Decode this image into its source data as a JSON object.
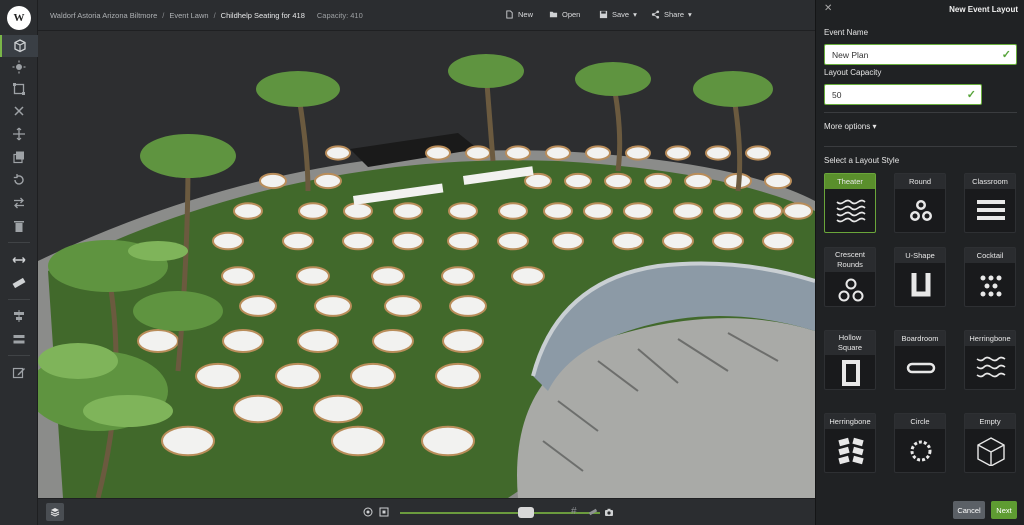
{
  "breadcrumb": {
    "venue": "Waldorf Astoria Arizona Biltmore",
    "space": "Event Lawn",
    "event": "Childhelp Seating for 418",
    "capacity": "Capacity: 410"
  },
  "toolbar": {
    "new_label": "New",
    "open_label": "Open",
    "save_label": "Save",
    "share_label": "Share"
  },
  "left_tools": [
    "cube-icon",
    "sun-icon",
    "frame-icon",
    "close-icon",
    "move-icon",
    "copy-icon",
    "rotate-icon",
    "swap-icon",
    "trash-icon",
    "measure-icon",
    "ruler-icon",
    "align-icon",
    "distribute-icon",
    "edit-icon"
  ],
  "zoom": {
    "level": 0.63
  },
  "panel": {
    "title": "New Event Layout",
    "event_name_label": "Event Name",
    "event_name_value": "New Plan",
    "capacity_label": "Layout Capacity",
    "capacity_value": "50",
    "more_options": "More options ▾",
    "style_label": "Select a Layout Style",
    "styles": [
      {
        "name": "Theater",
        "icon": "theater-icon",
        "selected": true
      },
      {
        "name": "Round",
        "icon": "round-icon"
      },
      {
        "name": "Classroom",
        "icon": "classroom-icon"
      },
      {
        "name": "Crescent\nRounds",
        "icon": "crescent-rounds-icon"
      },
      {
        "name": "U-Shape",
        "icon": "u-shape-icon"
      },
      {
        "name": "Cocktail",
        "icon": "cocktail-icon"
      },
      {
        "name": "Hollow\nSquare",
        "icon": "hollow-square-icon"
      },
      {
        "name": "Boardroom",
        "icon": "boardroom-icon"
      },
      {
        "name": "Herringbone",
        "icon": "herringbone-icon"
      },
      {
        "name": "Herringbone",
        "icon": "herringbone-alt-icon"
      },
      {
        "name": "Circle",
        "icon": "circle-icon"
      },
      {
        "name": "Empty",
        "icon": "empty-cube-icon"
      }
    ],
    "cancel_label": "Cancel",
    "next_label": "Next"
  },
  "colors": {
    "accent": "#6aae3e",
    "lawn": "#3f6b2a",
    "panel": "#202224"
  }
}
